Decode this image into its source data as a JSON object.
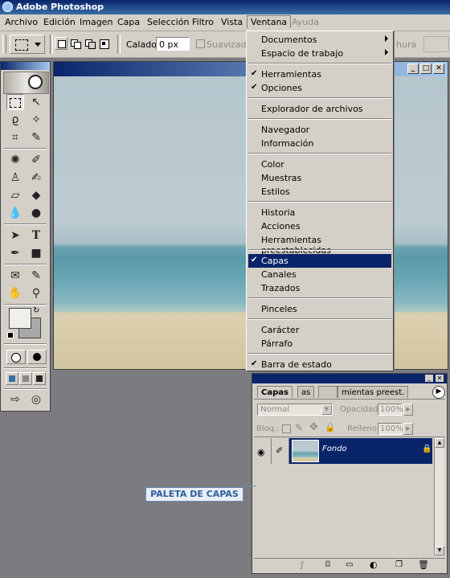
{
  "window": {
    "title": "Adobe Photoshop"
  },
  "menubar": {
    "items": [
      {
        "label": "Archivo"
      },
      {
        "label": "Edición"
      },
      {
        "label": "Imagen"
      },
      {
        "label": "Capa"
      },
      {
        "label": "Selección"
      },
      {
        "label": "Filtro"
      },
      {
        "label": "Vista"
      },
      {
        "label": "Ventana"
      },
      {
        "label": "Ayuda"
      }
    ]
  },
  "options_bar": {
    "feather_label": "Calado:",
    "feather_value": "0 px",
    "antialias_label": "Suavizado",
    "cut_text": "hura"
  },
  "window_menu": {
    "items": [
      {
        "label": "Documentos",
        "submenu": true
      },
      {
        "label": "Espacio de trabajo",
        "submenu": true
      },
      {
        "label": "Herramientas",
        "checked": true
      },
      {
        "label": "Opciones",
        "checked": true
      },
      {
        "label": "Explorador de archivos"
      },
      {
        "label": "Navegador"
      },
      {
        "label": "Información"
      },
      {
        "label": "Color"
      },
      {
        "label": "Muestras"
      },
      {
        "label": "Estilos"
      },
      {
        "label": "Historia"
      },
      {
        "label": "Acciones"
      },
      {
        "label": "Herramientas preestablecidas"
      },
      {
        "label": "Capas",
        "checked": true,
        "highlighted": true
      },
      {
        "label": "Canales"
      },
      {
        "label": "Trazados"
      },
      {
        "label": "Pinceles"
      },
      {
        "label": "Carácter"
      },
      {
        "label": "Párrafo"
      },
      {
        "label": "Barra de estado",
        "checked": true
      }
    ]
  },
  "layers_palette": {
    "tabs": [
      "Capas",
      "as",
      "mientas preest."
    ],
    "blend_mode": "Normal",
    "opacity_label": "Opacidad:",
    "opacity_value": "100%",
    "lock_label": "Bloq.:",
    "fill_label": "Relleno:",
    "fill_value": "100%",
    "layer_name": "Fondo"
  },
  "callout": {
    "text": "PALETA DE CAPAS"
  },
  "colors": {
    "menu_highlight": "#0a246a",
    "callout_text": "#2e5e9e"
  }
}
